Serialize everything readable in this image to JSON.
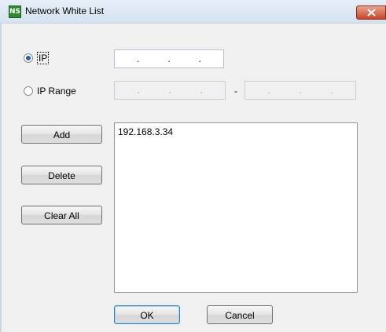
{
  "window": {
    "title": "Network White List",
    "icon": "app-logo-icon"
  },
  "mode": {
    "ip_label": "IP",
    "ip_range_label": "IP Range",
    "selected": "IP"
  },
  "ip_input": {
    "value": ". . ."
  },
  "ip_range": {
    "from": ". . .",
    "to": ". . .",
    "separator": "-"
  },
  "buttons": {
    "add": "Add",
    "delete": "Delete",
    "clear_all": "Clear All",
    "ok": "OK",
    "cancel": "Cancel"
  },
  "white_list": {
    "items": [
      "192.168.3.34"
    ]
  },
  "colors": {
    "close_button": "#c9452b",
    "radio_dot": "#2e5ea5"
  }
}
